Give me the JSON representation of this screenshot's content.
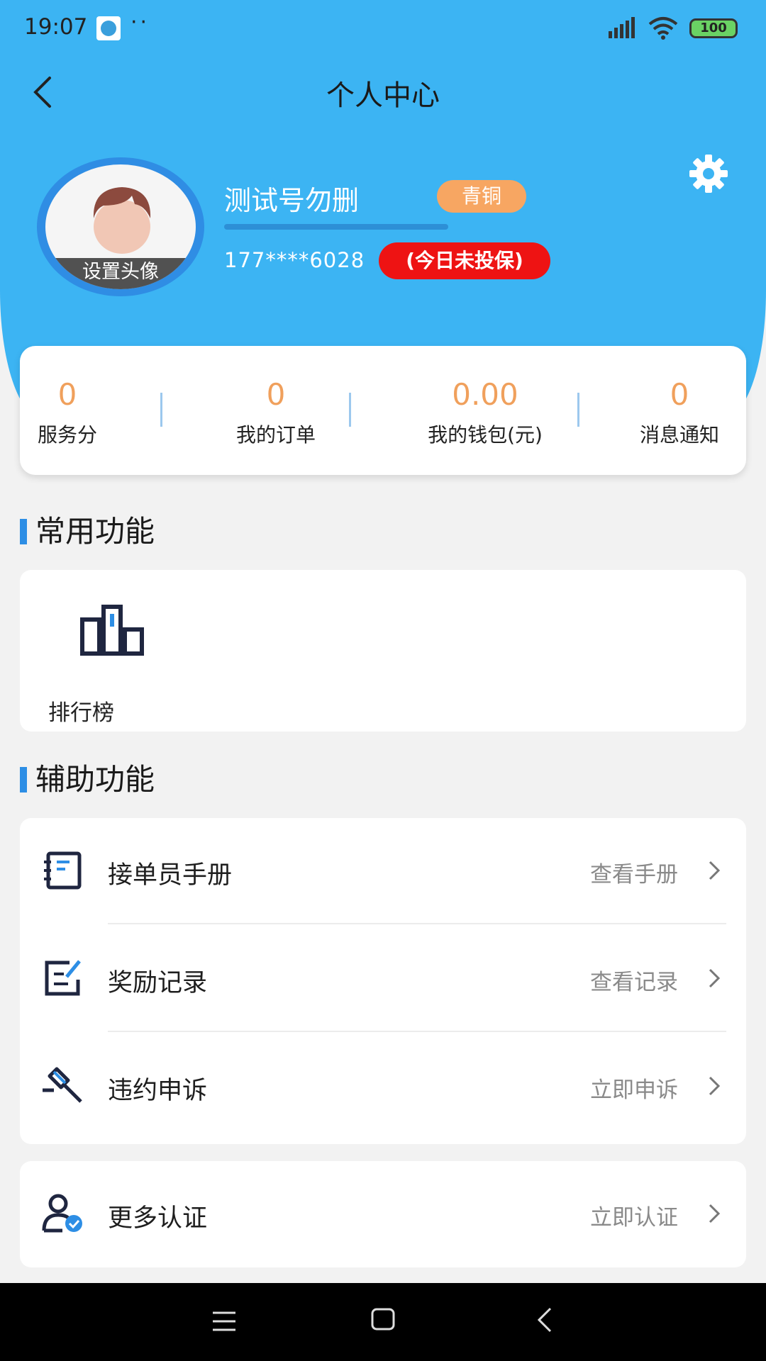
{
  "status_bar": {
    "time": "19:07",
    "dots": "··",
    "battery": "100"
  },
  "header": {
    "title": "个人中心"
  },
  "profile": {
    "avatar_caption": "设置头像",
    "username": "测试号勿删",
    "level": "青铜",
    "phone": "177****6028",
    "insurance_status": "(今日未投保)"
  },
  "stats": [
    {
      "value": "0",
      "label": "服务分"
    },
    {
      "value": "0",
      "label": "我的订单"
    },
    {
      "value": "0.00",
      "label": "我的钱包(元)"
    },
    {
      "value": "0",
      "label": "消息通知"
    }
  ],
  "common_section": {
    "title": "常用功能",
    "items": [
      {
        "label": "排行榜",
        "icon": "ranking-icon"
      }
    ]
  },
  "assist_section": {
    "title": "辅助功能",
    "items": [
      {
        "label": "接单员手册",
        "action": "查看手册",
        "icon": "manual-icon"
      },
      {
        "label": "奖励记录",
        "action": "查看记录",
        "icon": "reward-record-icon"
      },
      {
        "label": "违约申诉",
        "action": "立即申诉",
        "icon": "gavel-icon"
      }
    ]
  },
  "more_section": {
    "items": [
      {
        "label": "更多认证",
        "action": "立即认证",
        "icon": "user-verify-icon"
      }
    ]
  },
  "colors": {
    "header_bg": "#3cb4f3",
    "accent_blue": "#2d8ee5",
    "stat_value": "#f0a05c",
    "level_badge": "#f7a662",
    "insurance_badge": "#ee1313"
  }
}
